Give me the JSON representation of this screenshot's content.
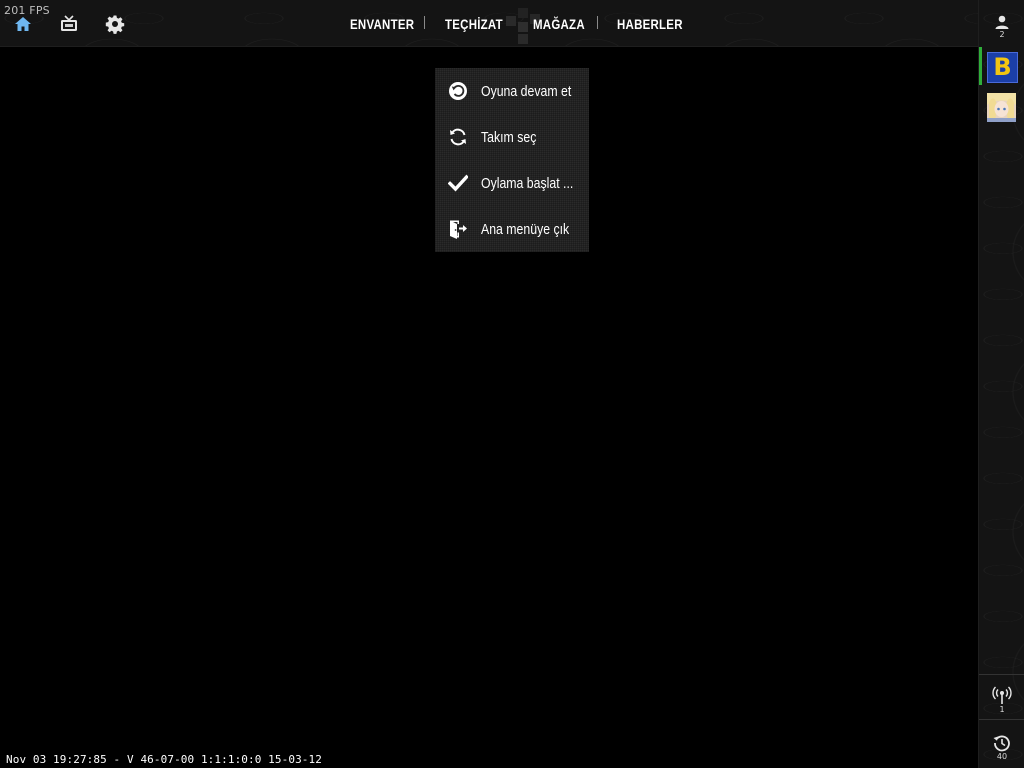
{
  "fps": "201 FPS",
  "nav": {
    "items": [
      "ENVANTER",
      "TEÇHİZAT",
      "MAĞAZA",
      "HABERLER"
    ]
  },
  "icons": {
    "home": "home-icon",
    "tv": "tv-icon",
    "settings": "gear-icon"
  },
  "sidebar": {
    "friends_count": "2",
    "avatar_letter": "B",
    "servers_count": "1",
    "history_count": "40"
  },
  "menu": {
    "items": [
      {
        "label": "Oyuna devam et",
        "icon": "undo-icon"
      },
      {
        "label": "Takım seç",
        "icon": "refresh-icon"
      },
      {
        "label": "Oylama başlat ...",
        "icon": "check-icon"
      },
      {
        "label": "Ana menüye çık",
        "icon": "exit-door-icon"
      }
    ]
  },
  "footer": {
    "version": "Nov 03 19:27:85 - V 46-07-00 1:1:1:0:0 15-03-12"
  },
  "colors": {
    "accent_home": "#6fb7f0",
    "online": "#2fae3a"
  }
}
